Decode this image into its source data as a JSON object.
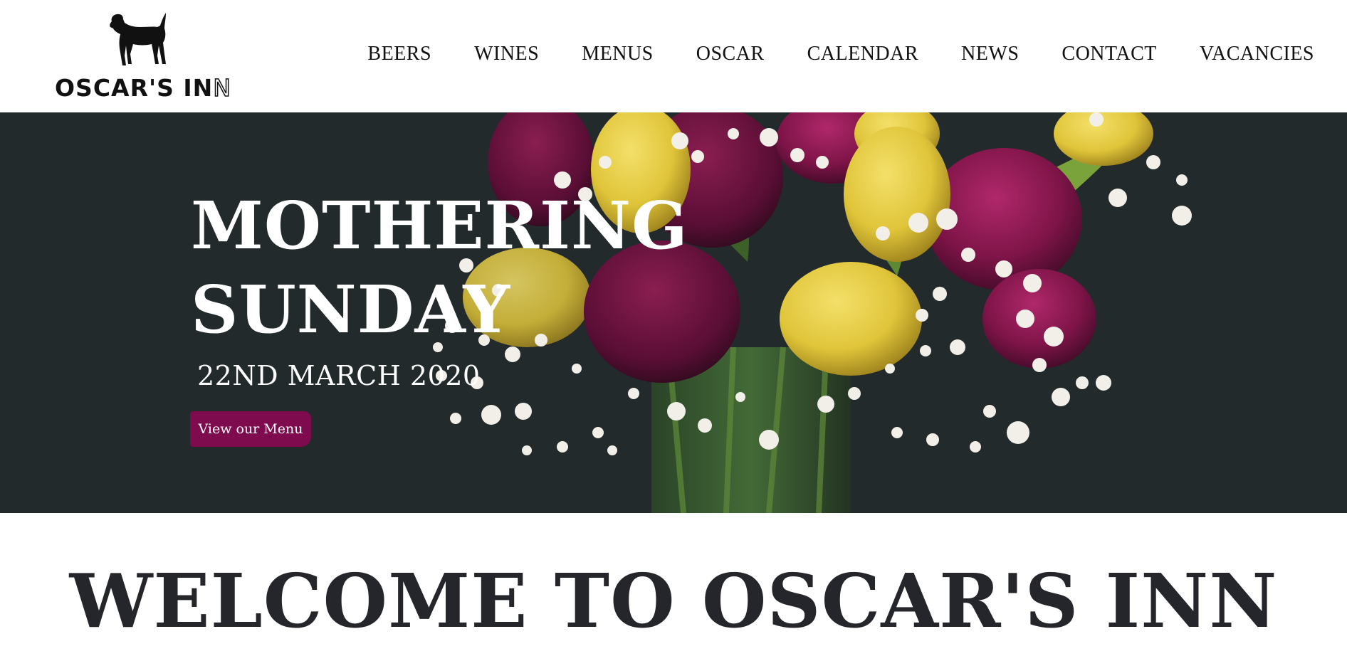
{
  "header": {
    "logo": {
      "text_main": "OSCAR'S IN",
      "text_outline": "N",
      "icon": "dog-icon"
    },
    "nav": [
      {
        "label": "BEERS"
      },
      {
        "label": "WINES"
      },
      {
        "label": "MENUS"
      },
      {
        "label": "OSCAR"
      },
      {
        "label": "CALENDAR"
      },
      {
        "label": "NEWS"
      },
      {
        "label": "CONTACT"
      },
      {
        "label": "VACANCIES"
      }
    ]
  },
  "hero": {
    "title_line1": "MOTHERING",
    "title_line2": "SUNDAY",
    "date": "22ND MARCH 2020",
    "button_label": "View our Menu",
    "background_color": "#222a2c",
    "button_color": "#7d0b4d",
    "image": "tulip-bouquet-image"
  },
  "main": {
    "heading": "WELCOME TO OSCAR'S INN"
  }
}
